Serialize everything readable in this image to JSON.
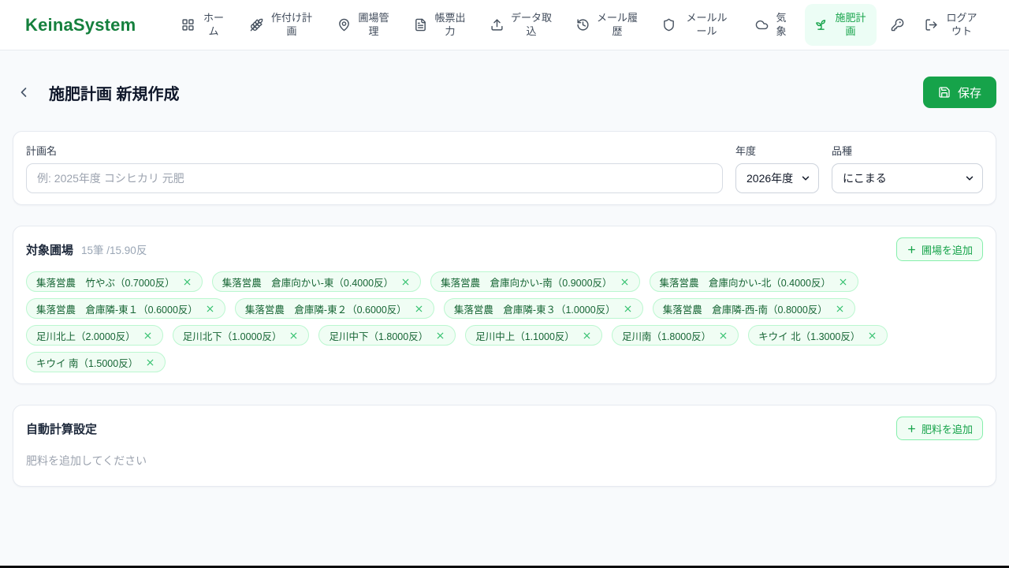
{
  "brand": "KeinaSystem",
  "nav": {
    "items": [
      {
        "label": "ホーム",
        "icon": "grid-icon"
      },
      {
        "label": "作付け計画",
        "icon": "wheat-icon"
      },
      {
        "label": "圃場管理",
        "icon": "map-pin-icon"
      },
      {
        "label": "帳票出力",
        "icon": "file-text-icon"
      },
      {
        "label": "データ取込",
        "icon": "upload-icon"
      },
      {
        "label": "メール履歴",
        "icon": "history-icon"
      },
      {
        "label": "メールルール",
        "icon": "shield-icon"
      },
      {
        "label": "気象",
        "icon": "cloud-icon"
      },
      {
        "label": "施肥計画",
        "icon": "sprout-icon",
        "active": true
      },
      {
        "label": "",
        "icon": "key-icon"
      },
      {
        "label": "ログアウト",
        "icon": "logout-icon"
      }
    ]
  },
  "page": {
    "title": "施肥計画 新規作成",
    "save_label": "保存"
  },
  "form": {
    "plan_name": {
      "label": "計画名",
      "placeholder": "例: 2025年度 コシヒカリ 元肥",
      "value": ""
    },
    "year": {
      "label": "年度",
      "value": "2026年度"
    },
    "variety": {
      "label": "品種",
      "value": "にこまる"
    }
  },
  "fields_section": {
    "title": "対象圃場",
    "summary": "15筆 /15.90反",
    "add_button": "圃場を追加",
    "chips": [
      "集落営農　竹やぶ（0.7000反）",
      "集落営農　倉庫向かい-東（0.4000反）",
      "集落営農　倉庫向かい-南（0.9000反）",
      "集落営農　倉庫向かい-北（0.4000反）",
      "集落営農　倉庫隣-東１（0.6000反）",
      "集落営農　倉庫隣-東２（0.6000反）",
      "集落営農　倉庫隣-東３（1.0000反）",
      "集落営農　倉庫隣-西-南（0.8000反）",
      "足川北上（2.0000反）",
      "足川北下（1.0000反）",
      "足川中下（1.8000反）",
      "足川中上（1.1000反）",
      "足川南（1.8000反）",
      "キウイ 北（1.3000反）",
      "キウイ 南（1.5000反）"
    ]
  },
  "auto_calc": {
    "title": "自動計算設定",
    "add_button": "肥料を追加",
    "empty_message": "肥料を追加してください"
  },
  "colors": {
    "brand_green": "#15803d",
    "accent_green": "#16a34a",
    "active_nav_bg": "#ecfdf5",
    "chip_bg": "#f0fdf4",
    "chip_border": "#bbf7d0",
    "page_bg": "#f8fafc"
  }
}
